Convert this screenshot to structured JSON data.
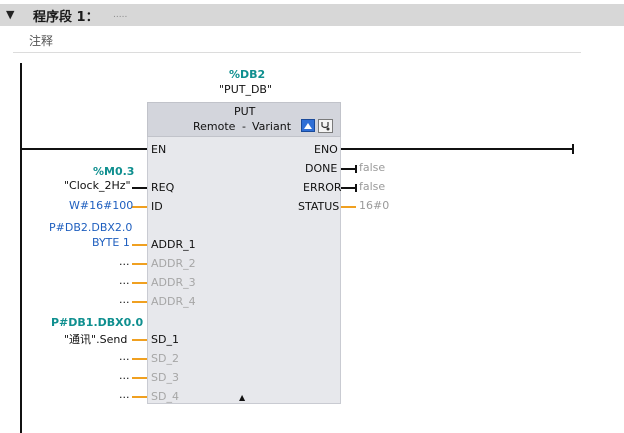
{
  "network": {
    "title": "程序段 1：",
    "title_suffix": ".....",
    "comment": "注释"
  },
  "instance": {
    "address": "%DB2",
    "name": "\"PUT_DB\""
  },
  "block": {
    "name": "PUT",
    "variant_left": "Remote",
    "variant_sep": "-",
    "variant_right": "Variant",
    "expand_arrow": "▲"
  },
  "inputs": {
    "en": "EN",
    "req": "REQ",
    "id": "ID",
    "addr1": "ADDR_1",
    "addr2": "ADDR_2",
    "addr3": "ADDR_3",
    "addr4": "ADDR_4",
    "sd1": "SD_1",
    "sd2": "SD_2",
    "sd3": "SD_3",
    "sd4": "SD_4"
  },
  "outputs": {
    "eno": "ENO",
    "done": "DONE",
    "error": "ERROR",
    "status": "STATUS"
  },
  "operands": {
    "req_addr": "%M0.3",
    "req_name": "\"Clock_2Hz\"",
    "id_value": "W#16#100",
    "addr1_line1": "P#DB2.DBX2.0",
    "addr1_line2": "BYTE 1",
    "placeholder": "...",
    "sd1_addr": "P#DB1.DBX0.0",
    "sd1_name": "\"通讯\".Send",
    "done_value": "false",
    "error_value": "false",
    "status_value": "16#0"
  },
  "colors": {
    "header_bg": "#d7d7d7",
    "block_bg": "#e7e8ec",
    "block_header_bg": "#d3d5dc",
    "address_teal": "#0f8f8f",
    "constant_blue": "#1f5fbf",
    "wire_orange": "#f0a020",
    "unused_gray": "#a6a6a6"
  }
}
